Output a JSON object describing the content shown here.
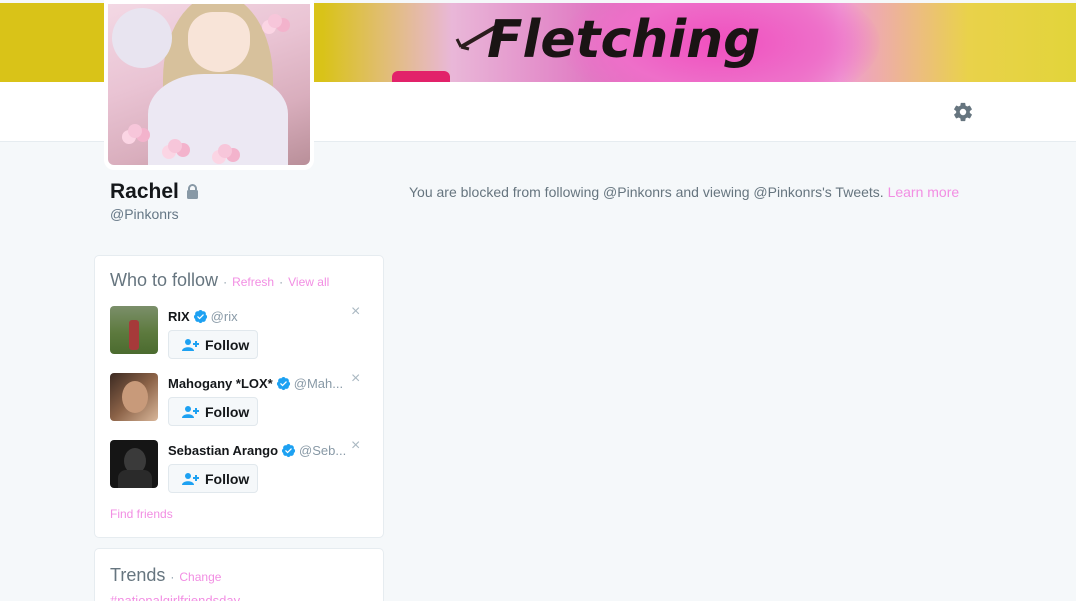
{
  "banner": {
    "title": "Fletching"
  },
  "profile": {
    "name": "Rachel",
    "handle": "@Pinkonrs",
    "protected_icon": "lock-icon"
  },
  "notice": {
    "text": "You are blocked from following @Pinkonrs and viewing @Pinkonrs's Tweets.",
    "link": "Learn more"
  },
  "who_to_follow": {
    "title": "Who to follow",
    "sep": "·",
    "refresh": "Refresh",
    "view_all": "View all",
    "users": [
      {
        "name": "RIX",
        "handle": "@rix",
        "verified": true,
        "button": "Follow",
        "dismiss": "×"
      },
      {
        "name": "Mahogany *LOX*",
        "handle": "@Mah...",
        "verified": true,
        "button": "Follow",
        "dismiss": "×"
      },
      {
        "name": "Sebastian Arango",
        "handle": "@Seb...",
        "verified": true,
        "button": "Follow",
        "dismiss": "×"
      }
    ],
    "find_friends": "Find friends"
  },
  "trends": {
    "title": "Trends",
    "sep": "·",
    "change": "Change",
    "items": [
      "#nationalgirlfriendsday"
    ]
  },
  "colors": {
    "link": "#f28ee3",
    "verified": "#1da1f2",
    "background": "#f5f8fa"
  },
  "icons": {
    "settings": "gear-icon",
    "verified": "verified-badge-icon",
    "follow": "add-user-icon"
  }
}
